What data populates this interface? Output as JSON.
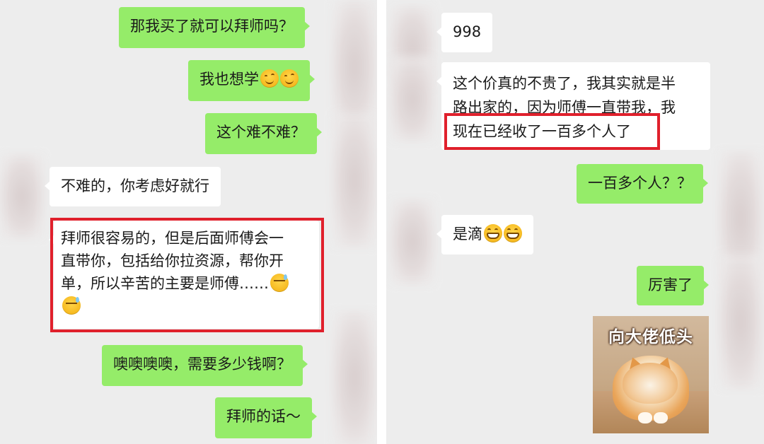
{
  "left_chat": {
    "messages": [
      {
        "side": "out",
        "text": "那我买了就可以拜师吗？"
      },
      {
        "side": "out",
        "text": "我也想学",
        "emojis": [
          "smile-emoji",
          "smile-emoji"
        ]
      },
      {
        "side": "out",
        "text": "这个难不难？"
      },
      {
        "side": "in",
        "text": "不难的，你考虑好就行"
      },
      {
        "side": "in",
        "lines": [
          "拜师很容易的，但是后面师傅会一",
          "直带你，包括给你拉资源，帮你开",
          "单，所以辛苦的主要是师傅……"
        ],
        "emojis": [
          "sweat-emoji",
          "sweat-emoji"
        ]
      },
      {
        "side": "out",
        "text": "噢噢噢噢，需要多少钱啊？"
      },
      {
        "side": "out",
        "text": "拜师的话～"
      }
    ]
  },
  "right_chat": {
    "messages": [
      {
        "side": "in",
        "text": "998"
      },
      {
        "side": "in",
        "lines": [
          "这个价真的不贵了，我其实就是半",
          "路出家的，因为师傅一直带我，我",
          "现在已经收了一百多个人了"
        ]
      },
      {
        "side": "out",
        "text": "一百多个人？？"
      },
      {
        "side": "in",
        "text": "是滴",
        "emojis": [
          "grin-emoji",
          "grin-emoji"
        ]
      },
      {
        "side": "out",
        "text": "厉害了"
      },
      {
        "side": "out",
        "sticker": {
          "caption": "向大佬低头",
          "icon": "cat-bowing-sticker"
        }
      }
    ]
  },
  "colors": {
    "outgoing_bubble": "#95ec69",
    "incoming_bubble": "#ffffff",
    "chat_background": "#ededed",
    "highlight_box": "#e0202c"
  }
}
